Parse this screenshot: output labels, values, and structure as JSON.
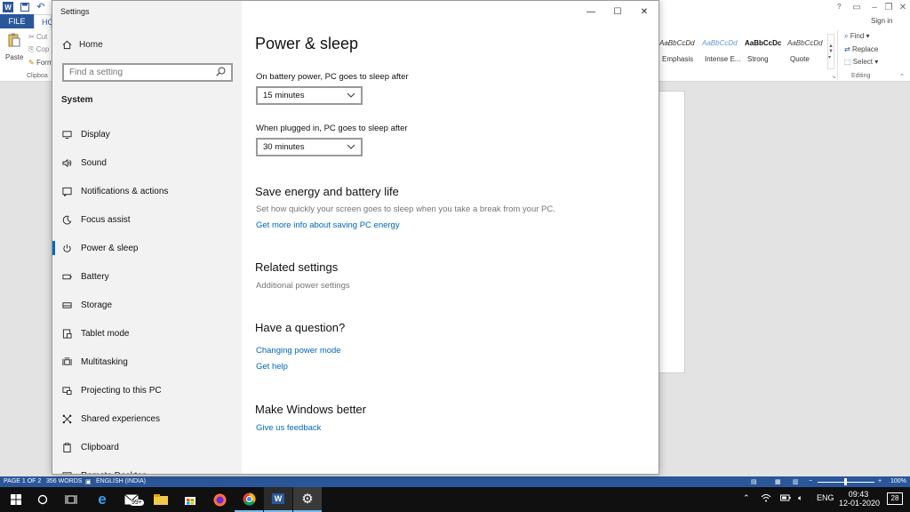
{
  "word": {
    "tabs": {
      "file": "FILE",
      "home": "HO"
    },
    "clipboard": {
      "cut": "Cut",
      "copy": "Cop",
      "format": "Form",
      "paste": "Paste",
      "label": "Clipboa"
    },
    "styles": [
      {
        "sample": "AaBbCcDd",
        "name": "Emphasis",
        "color": "#333333",
        "italic": true
      },
      {
        "sample": "AaBbCcDd",
        "name": "Intense E...",
        "color": "#5b9bd5",
        "italic": true
      },
      {
        "sample": "AaBbCcDc",
        "name": "Strong",
        "color": "#111111",
        "bold": true
      },
      {
        "sample": "AaBbCcDd",
        "name": "Quote",
        "color": "#444444",
        "italic": true
      }
    ],
    "editing": {
      "find": "Find",
      "replace": "Replace",
      "select": "Select",
      "label": "Editing"
    },
    "sign_in": "Sign in",
    "help": "?"
  },
  "statusbar": {
    "page": "PAGE 1 OF 2",
    "words": "356 WORDS",
    "language": "ENGLISH (INDIA)",
    "zoom": "100%"
  },
  "settings": {
    "window_title": "Settings",
    "home": "Home",
    "search_placeholder": "Find a setting",
    "section": "System",
    "nav": [
      {
        "label": "Display",
        "icon": "monitor-icon"
      },
      {
        "label": "Sound",
        "icon": "speaker-icon"
      },
      {
        "label": "Notifications & actions",
        "icon": "notification-icon"
      },
      {
        "label": "Focus assist",
        "icon": "moon-icon"
      },
      {
        "label": "Power & sleep",
        "icon": "power-icon",
        "selected": true
      },
      {
        "label": "Battery",
        "icon": "battery-icon"
      },
      {
        "label": "Storage",
        "icon": "storage-icon"
      },
      {
        "label": "Tablet mode",
        "icon": "tablet-icon"
      },
      {
        "label": "Multitasking",
        "icon": "multitasking-icon"
      },
      {
        "label": "Projecting to this PC",
        "icon": "projecting-icon"
      },
      {
        "label": "Shared experiences",
        "icon": "shared-icon"
      },
      {
        "label": "Clipboard",
        "icon": "clipboard-icon"
      },
      {
        "label": "Remote Desktop",
        "icon": "remote-icon"
      }
    ],
    "content": {
      "title": "Power & sleep",
      "battery_label": "On battery power, PC goes to sleep after",
      "battery_value": "15 minutes",
      "plugged_label": "When plugged in, PC goes to sleep after",
      "plugged_value": "30 minutes",
      "save_heading": "Save energy and battery life",
      "save_desc": "Set how quickly your screen goes to sleep when you take a break from your PC.",
      "save_link": "Get more info about saving PC energy",
      "related_heading": "Related settings",
      "related_link": "Additional power settings",
      "question_heading": "Have a question?",
      "question_link1": "Changing power mode",
      "question_link2": "Get help",
      "better_heading": "Make Windows better",
      "better_link": "Give us feedback"
    }
  },
  "taskbar": {
    "mail_badge": "99+",
    "language": "ENG",
    "time": "09:43",
    "date": "12-01-2020",
    "notifications": "28"
  },
  "colors": {
    "accent": "#0067c0",
    "word_blue": "#2b579a",
    "taskbar": "#101010"
  }
}
